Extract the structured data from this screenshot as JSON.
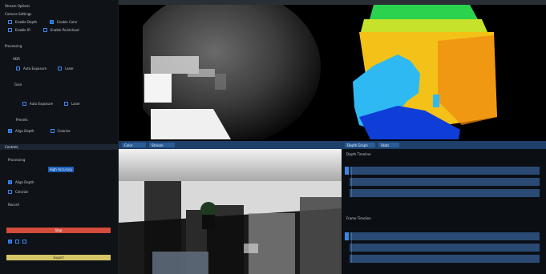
{
  "sidebar": {
    "title": "Stream Options",
    "section_settings": "Camera Settings",
    "checkbox1": "Enable Depth",
    "checkbox2": "Enable Color",
    "checkbox3": "Enable IR",
    "checkbox4": "Enable Pointcloud",
    "section_processing": "Processing",
    "section_hdr": "HDR",
    "checkbox5": "Auto Exposure",
    "checkbox6": "Laser",
    "label_gain": "Gain",
    "section_presets": "Presets",
    "btn_high_accuracy": "High Accuracy",
    "label_controls": "Controls",
    "checkbox7": "Align Depth",
    "checkbox8": "Colorize",
    "bar_red_label": "Stop",
    "label_record": "Record",
    "bar_yellow_label": "Export"
  },
  "panels": {
    "rgb_tabs": [
      "Color",
      "Stream"
    ],
    "right_tabs": [
      "Depth Graph",
      "Stats"
    ],
    "right_caption_1": "Depth Timeline",
    "right_caption_2": "Frame Timeline"
  }
}
